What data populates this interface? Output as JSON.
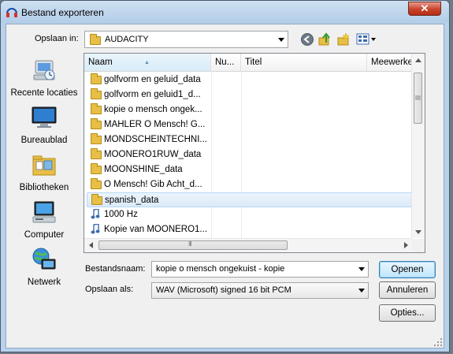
{
  "window": {
    "title": "Bestand exporteren",
    "close_label": "✕"
  },
  "top": {
    "save_in_label": "Opslaan in:",
    "folder_value": "AUDACITY",
    "toolbar_icons": [
      "back-icon",
      "up-folder-icon",
      "new-folder-icon",
      "view-menu-icon"
    ]
  },
  "places": [
    {
      "label": "Recente locaties",
      "icon": "recent-places-icon"
    },
    {
      "label": "Bureaublad",
      "icon": "desktop-icon"
    },
    {
      "label": "Bibliotheken",
      "icon": "libraries-icon"
    },
    {
      "label": "Computer",
      "icon": "computer-icon"
    },
    {
      "label": "Netwerk",
      "icon": "network-icon"
    }
  ],
  "list": {
    "columns": [
      "Naam",
      "Nu...",
      "Titel",
      "Meewerkend"
    ],
    "rows": [
      {
        "name": "golfvorm en geluid_data",
        "type": "folder",
        "selected": false
      },
      {
        "name": "golfvorm en geluid1_d...",
        "type": "folder",
        "selected": false
      },
      {
        "name": "kopie o mensch ongek...",
        "type": "folder",
        "selected": false
      },
      {
        "name": "MAHLER  O Mensch! G...",
        "type": "folder",
        "selected": false
      },
      {
        "name": "MONDSCHEINTECHNI...",
        "type": "folder",
        "selected": false
      },
      {
        "name": "MOONERO1RUW_data",
        "type": "folder",
        "selected": false
      },
      {
        "name": "MOONSHINE_data",
        "type": "folder",
        "selected": false
      },
      {
        "name": "O Mensch! Gib Acht_d...",
        "type": "folder",
        "selected": false
      },
      {
        "name": "spanish_data",
        "type": "folder",
        "selected": true
      },
      {
        "name": "1000 Hz",
        "type": "audio",
        "selected": false
      },
      {
        "name": "Kopie van MOONERO1...",
        "type": "audio",
        "selected": false
      }
    ],
    "hscroll_grip": "III"
  },
  "bottom": {
    "filename_label": "Bestandsnaam:",
    "filename_value": "kopie o mensch ongekuist - kopie",
    "saveas_label": "Opslaan als:",
    "saveas_value": "WAV (Microsoft) signed 16 bit PCM",
    "open_button": "Openen",
    "cancel_button": "Annuleren",
    "options_button": "Opties..."
  },
  "colors": {
    "frame": "#b9d1ea",
    "selection": "#dbeaf7",
    "folder": "#e7be46",
    "close": "#c8432b"
  }
}
